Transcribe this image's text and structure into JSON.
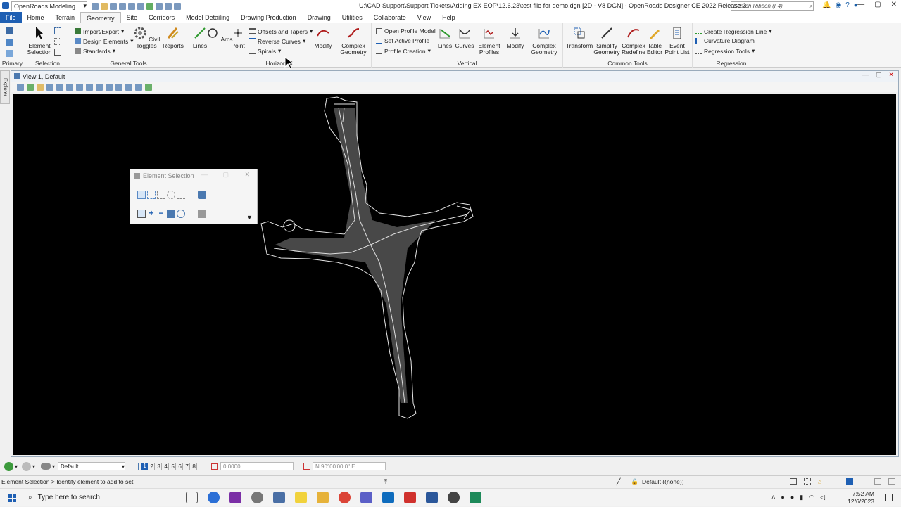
{
  "titlebar": {
    "workspace": "OpenRoads Modeling",
    "title": "U:\\CAD Support\\Support Tickets\\Adding EX EOP\\12.6.23\\test file for demo.dgn [2D - V8 DGN] - OpenRoads Designer CE 2022 Release 3",
    "search_placeholder": "Search Ribbon (F4)"
  },
  "tabs": [
    "File",
    "Home",
    "Terrain",
    "Geometry",
    "Site",
    "Corridors",
    "Model Detailing",
    "Drawing Production",
    "Drawing",
    "Utilities",
    "Collaborate",
    "View",
    "Help"
  ],
  "active_tab": "Geometry",
  "ribbon": {
    "primary": {
      "label": "Primary"
    },
    "selection": {
      "label": "Selection",
      "element_selection": "Element Selection"
    },
    "general": {
      "label": "General Tools",
      "import_export": "Import/Export",
      "design_elements": "Design Elements",
      "standards": "Standards",
      "civil_toggles": "Civil Toggles",
      "reports": "Reports"
    },
    "horizontal": {
      "label": "Horizontal",
      "lines": "Lines",
      "arcs": "Arcs",
      "point": "Point",
      "offsets": "Offsets and Tapers",
      "reverse": "Reverse Curves",
      "spirals": "Spirals",
      "modify": "Modify",
      "complex": "Complex Geometry"
    },
    "vertical": {
      "label": "Vertical",
      "open_profile": "Open Profile Model",
      "set_active": "Set Active Profile",
      "profile_creation": "Profile Creation",
      "lines": "Lines",
      "curves": "Curves",
      "element_profiles": "Element Profiles",
      "modify": "Modify",
      "complex": "Complex Geometry"
    },
    "common": {
      "label": "Common Tools",
      "transform": "Transform",
      "simplify": "Simplify Geometry",
      "complex_redefine": "Complex Redefine",
      "table_editor": "Table Editor",
      "event_point": "Event Point List"
    },
    "regression": {
      "label": "Regression",
      "create": "Create Regression Line",
      "curvature": "Curvature Diagram",
      "tools": "Regression Tools"
    }
  },
  "view": {
    "title": "View 1, Default"
  },
  "explorer_label": "Explorer",
  "element_selection_dialog": {
    "title": "Element Selection"
  },
  "bottom": {
    "view_group": "Default",
    "views": [
      "1",
      "2",
      "3",
      "4",
      "5",
      "6",
      "7",
      "8"
    ],
    "distance": "0.0000",
    "bearing": "N 90°00'00.0\" E"
  },
  "status": {
    "prompt": "Element Selection > Identify element to add to set",
    "level": "Default ((none))"
  },
  "taskbar": {
    "search": "Type here to search",
    "time": "7:52 AM",
    "date": "12/6/2023"
  }
}
